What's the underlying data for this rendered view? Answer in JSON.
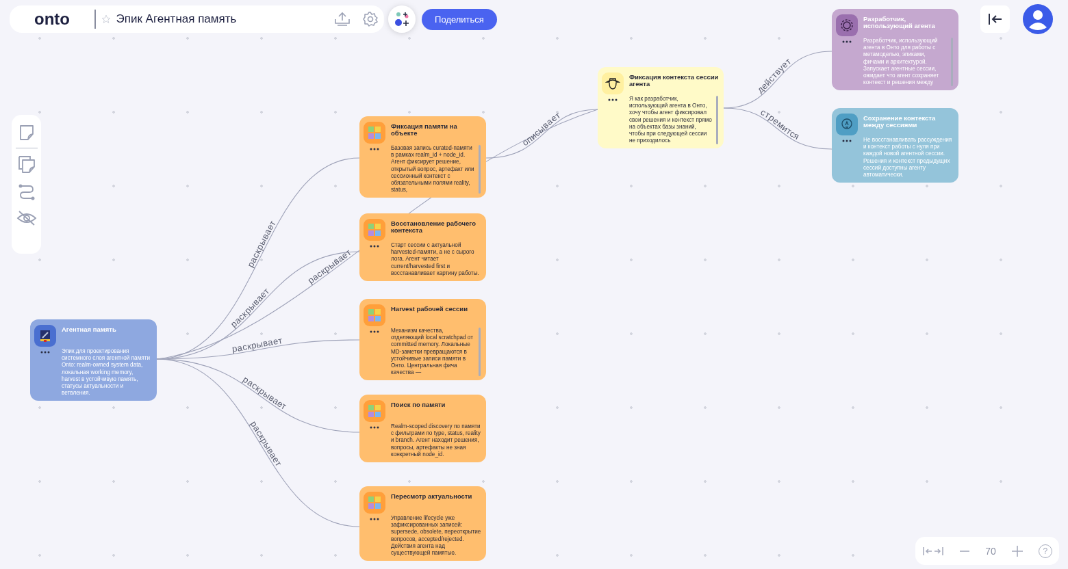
{
  "header": {
    "logo": "onto",
    "favorite": false,
    "title": "Эпик Агентная память",
    "share_button": "Поделиться"
  },
  "nodes": [
    {
      "kind": "epic",
      "title": "Агентная память",
      "text": "Эпик для проектирования системного слоя агентной памяти Onto: realm-owned system data, локальная working memory, harvest в устойчивую память, статусы актуальности и ветвления.",
      "scrollable": false
    },
    {
      "kind": "feature",
      "title": "Фиксация памяти на объекте",
      "text": "Базовая запись curated-памяти в рамках realm_id + node_id. Агент фиксирует решение, открытый вопрос, артефакт или сессионный контекст с обязательными полями reality, status,",
      "scrollable": true
    },
    {
      "kind": "feature",
      "title": "Восстановление рабочего контекста",
      "text": "Старт сессии с актуальной harvested-памяти, а не с сырого лога. Агент читает current/harvested first и восстанавливает картину работы.",
      "scrollable": false
    },
    {
      "kind": "feature",
      "title": "Harvest рабочей сессии",
      "text": "Механизм качества, отделяющий local scratchpad от committed memory. Локальные MD-заметки превращаются в устойчивые записи памяти в Онто. Центральная фича качества —",
      "scrollable": true
    },
    {
      "kind": "feature",
      "title": "Поиск по памяти",
      "text": "Realm-scoped discovery по памяти с фильтрами по type, status, reality и branch. Агент находит решения, вопросы, артефакты не зная конкретный node_id.",
      "scrollable": false
    },
    {
      "kind": "feature",
      "title": "Пересмотр актуальности",
      "text": "Управление lifecycle уже зафиксированных записей: supersede, obsolete, переоткрытие вопросов, accepted/rejected. Действия агента над существующей памятью.",
      "scrollable": false
    },
    {
      "kind": "story",
      "title": "Фиксация контекста сессии агента",
      "text": "Я как разработчик, использующий агента в Онто, хочу чтобы агент фиксировал свои решения и контекст прямо на объектах базы знаний, чтобы при следующей сессии не приходилось",
      "scrollable": true
    },
    {
      "kind": "persona",
      "title": "Разработчик, использующий агента",
      "text": "Разработчик, использующий агента в Онто для работы с метамоделью, эпиками, фичами и архитектурой. Запускает агентные сессии, ожидает что агент сохраняет контекст и решения между",
      "scrollable": true
    },
    {
      "kind": "goal",
      "title": "Сохранение контекста между сессиями",
      "text": "Не восстанавливать рассуждения и контекст работы с нуля при каждой новой агентной сессии. Решения и контекст предыдущих сессий доступны агенту автоматически.",
      "scrollable": false
    }
  ],
  "edges": [
    {
      "label": "раскрывает"
    },
    {
      "label": "раскрывает"
    },
    {
      "label": "раскрывает"
    },
    {
      "label": "раскрывает"
    },
    {
      "label": "раскрывает"
    },
    {
      "label": "раскрывает"
    },
    {
      "label": "описывает"
    },
    {
      "label": "действует"
    },
    {
      "label": "стремится"
    }
  ],
  "zoom": {
    "value": "70",
    "help": "?"
  }
}
